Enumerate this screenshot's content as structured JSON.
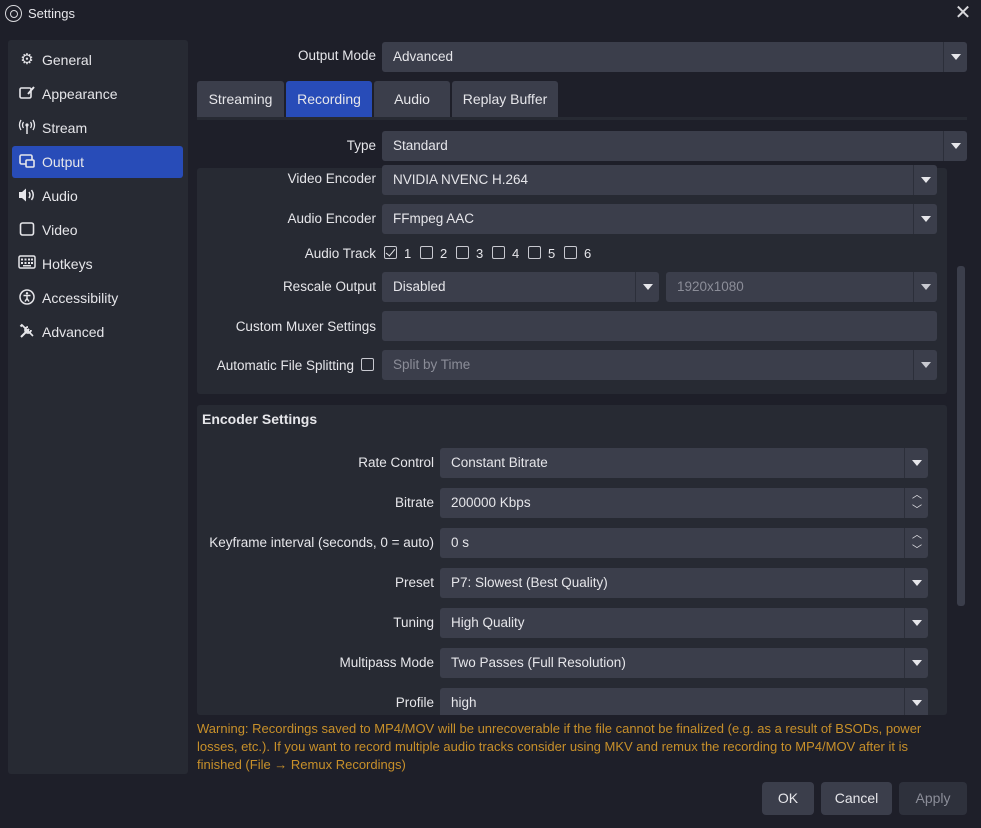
{
  "window": {
    "title": "Settings"
  },
  "sidebar": {
    "items": [
      {
        "label": "General",
        "icon": "gear-icon",
        "glyph": "⚙"
      },
      {
        "label": "Appearance",
        "icon": "appearance-icon",
        "glyph": "🖌"
      },
      {
        "label": "Stream",
        "icon": "broadcast-icon",
        "glyph": "((•))"
      },
      {
        "label": "Output",
        "icon": "output-icon",
        "glyph": "⧉"
      },
      {
        "label": "Audio",
        "icon": "speaker-icon",
        "glyph": "🔊"
      },
      {
        "label": "Video",
        "icon": "monitor-icon",
        "glyph": "▭"
      },
      {
        "label": "Hotkeys",
        "icon": "keyboard-icon",
        "glyph": "⌨"
      },
      {
        "label": "Accessibility",
        "icon": "accessibility-icon",
        "glyph": "♿"
      },
      {
        "label": "Advanced",
        "icon": "tools-icon",
        "glyph": "✂"
      }
    ],
    "active": "Output"
  },
  "output_mode": {
    "label": "Output Mode",
    "value": "Advanced"
  },
  "tabs": [
    "Streaming",
    "Recording",
    "Audio",
    "Replay Buffer"
  ],
  "active_tab": "Recording",
  "recording": {
    "type": {
      "label": "Type",
      "value": "Standard"
    },
    "video_encoder": {
      "label": "Video Encoder",
      "value": "NVIDIA NVENC H.264"
    },
    "audio_encoder": {
      "label": "Audio Encoder",
      "value": "FFmpeg AAC"
    },
    "audio_track": {
      "label": "Audio Track",
      "tracks": [
        "1",
        "2",
        "3",
        "4",
        "5",
        "6"
      ],
      "checked": [
        true,
        false,
        false,
        false,
        false,
        false
      ]
    },
    "rescale_output": {
      "label": "Rescale Output",
      "value": "Disabled",
      "resolution": "1920x1080"
    },
    "custom_muxer": {
      "label": "Custom Muxer Settings",
      "value": ""
    },
    "file_splitting": {
      "label": "Automatic File Splitting",
      "checked": false,
      "value": "Split by Time"
    }
  },
  "encoder_settings": {
    "title": "Encoder Settings",
    "rate_control": {
      "label": "Rate Control",
      "value": "Constant Bitrate"
    },
    "bitrate": {
      "label": "Bitrate",
      "value": "200000 Kbps"
    },
    "keyframe": {
      "label": "Keyframe interval (seconds, 0 = auto)",
      "value": "0 s"
    },
    "preset": {
      "label": "Preset",
      "value": "P7: Slowest (Best Quality)"
    },
    "tuning": {
      "label": "Tuning",
      "value": "High Quality"
    },
    "multipass": {
      "label": "Multipass Mode",
      "value": "Two Passes (Full Resolution)"
    },
    "profile": {
      "label": "Profile",
      "value": "high"
    }
  },
  "warning": "Warning: Recordings saved to MP4/MOV will be unrecoverable if the file cannot be finalized (e.g. as a result of BSODs, power losses, etc.). If you want to record multiple audio tracks consider using MKV and remux the recording to MP4/MOV after it is finished (File → Remux Recordings)",
  "buttons": {
    "ok": "OK",
    "cancel": "Cancel",
    "apply": "Apply"
  },
  "colors": {
    "accent": "#284cb8",
    "background": "#1e1f29",
    "panel": "#272a33",
    "control": "#3b3e4b",
    "warning": "#c8902a"
  }
}
